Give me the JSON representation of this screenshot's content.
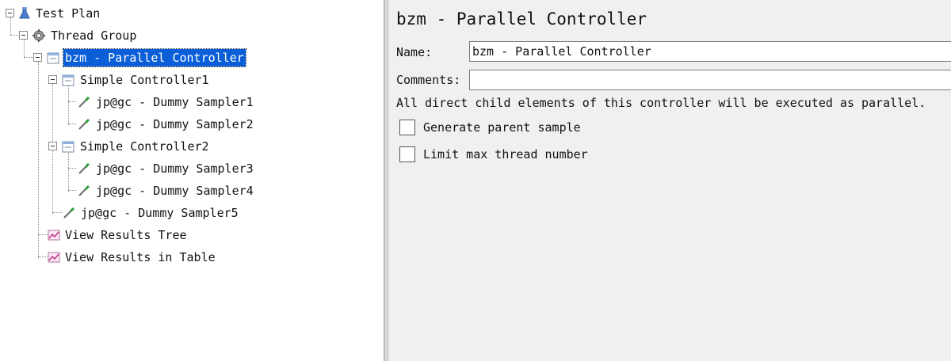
{
  "tree": {
    "test_plan": "Test Plan",
    "thread_group": "Thread Group",
    "parallel_controller": "bzm - Parallel Controller",
    "simple_controller_1": "Simple Controller1",
    "dummy_sampler_1": "jp@gc - Dummy Sampler1",
    "dummy_sampler_2": "jp@gc - Dummy Sampler2",
    "simple_controller_2": "Simple Controller2",
    "dummy_sampler_3": "jp@gc - Dummy Sampler3",
    "dummy_sampler_4": "jp@gc - Dummy Sampler4",
    "dummy_sampler_5": "jp@gc - Dummy Sampler5",
    "view_results_tree": "View Results Tree",
    "view_results_table": "View Results in Table",
    "selected": "bzm - Parallel Controller",
    "icons": {
      "test_plan": "flask-icon",
      "thread_group": "gear-icon",
      "controller": "controller-icon",
      "sampler": "pipette-icon",
      "listener": "graph-icon"
    }
  },
  "panel": {
    "title": "bzm - Parallel Controller",
    "name_label": "Name:",
    "name_value": "bzm - Parallel Controller",
    "comments_label": "Comments:",
    "comments_value": "",
    "description": "All direct child elements of this controller will be executed as parallel.",
    "generate_parent_label": "Generate parent sample",
    "generate_parent_checked": false,
    "limit_threads_label": "Limit max thread number",
    "limit_threads_checked": false
  },
  "colors": {
    "selection": "#0a5fd8",
    "pane_background": "#f0f0f0",
    "tree_background": "#ffffff"
  }
}
